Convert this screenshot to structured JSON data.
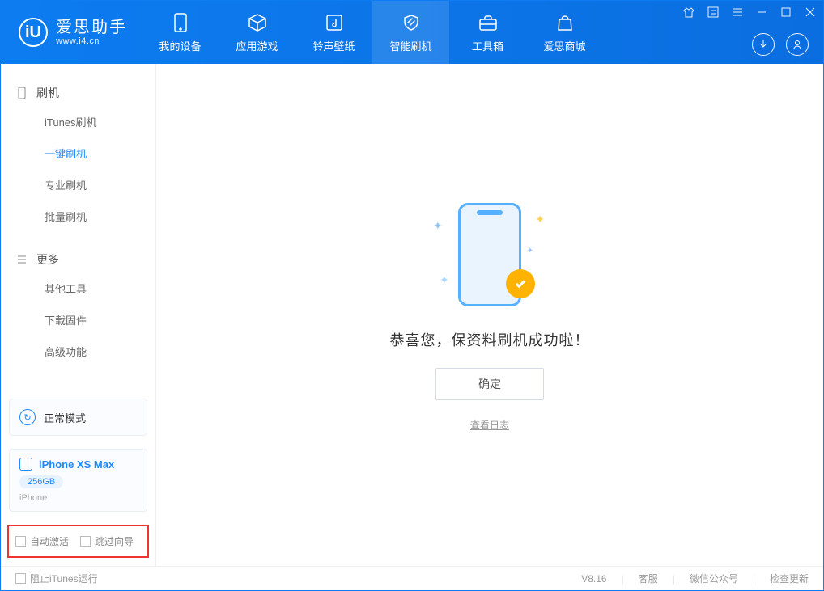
{
  "app": {
    "title": "爱思助手",
    "subtitle": "www.i4.cn"
  },
  "tabs": [
    {
      "label": "我的设备",
      "icon": "device"
    },
    {
      "label": "应用游戏",
      "icon": "cube"
    },
    {
      "label": "铃声壁纸",
      "icon": "music"
    },
    {
      "label": "智能刷机",
      "icon": "shield",
      "active": true
    },
    {
      "label": "工具箱",
      "icon": "toolbox"
    },
    {
      "label": "爱思商城",
      "icon": "bag"
    }
  ],
  "sidebar": {
    "group1": {
      "title": "刷机",
      "items": [
        "iTunes刷机",
        "一键刷机",
        "专业刷机",
        "批量刷机"
      ],
      "activeIndex": 1
    },
    "group2": {
      "title": "更多",
      "items": [
        "其他工具",
        "下载固件",
        "高级功能"
      ]
    }
  },
  "mode": {
    "label": "正常模式"
  },
  "device": {
    "name": "iPhone XS Max",
    "storage": "256GB",
    "type": "iPhone"
  },
  "options": {
    "opt1": "自动激活",
    "opt2": "跳过向导"
  },
  "main": {
    "message": "恭喜您，保资料刷机成功啦！",
    "ok": "确定",
    "logLink": "查看日志"
  },
  "status": {
    "blockItunes": "阻止iTunes运行",
    "version": "V8.16",
    "links": [
      "客服",
      "微信公众号",
      "检查更新"
    ]
  }
}
